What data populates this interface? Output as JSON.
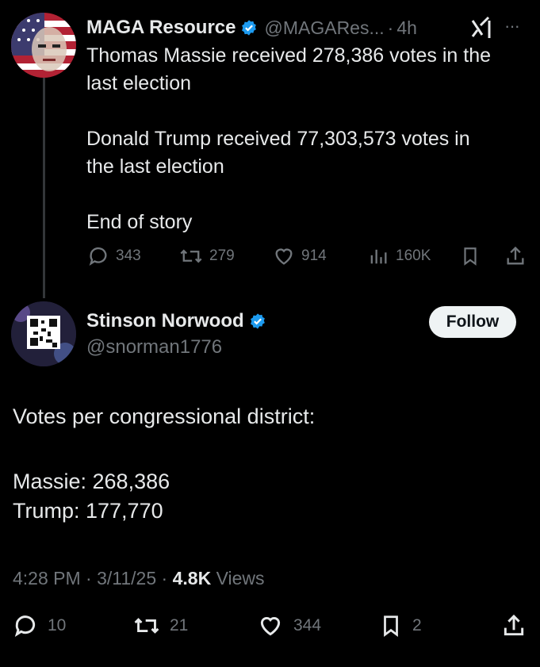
{
  "tweet1": {
    "author_name": "MAGA Resource",
    "handle": "@MAGARes...",
    "dot": "·",
    "time": "4h",
    "more": "···",
    "lines": [
      "Thomas Massie received 278,386 votes in the",
      "last election",
      "Donald Trump received 77,303,573 votes in",
      "the last election",
      "End of story"
    ],
    "actions": {
      "replies": "343",
      "reposts": "279",
      "likes": "914",
      "views": "160K"
    }
  },
  "tweet2": {
    "author_name": "Stinson Norwood",
    "handle": "@snorman1776",
    "follow_label": "Follow",
    "lines": [
      "Votes per congressional district:",
      "Massie: 268,386",
      "Trump: 177,770"
    ],
    "meta": {
      "time": "4:28 PM",
      "sep1": "·",
      "date": "3/11/25",
      "sep2": "·",
      "views_count": "4.8K",
      "views_label": "Views"
    },
    "actions": {
      "replies": "10",
      "reposts": "21",
      "likes": "344",
      "bookmarks": "2"
    }
  },
  "colors": {
    "background": "#000000",
    "text": "#e7e9ea",
    "muted": "#71767b",
    "verified": "#1d9bf0"
  }
}
